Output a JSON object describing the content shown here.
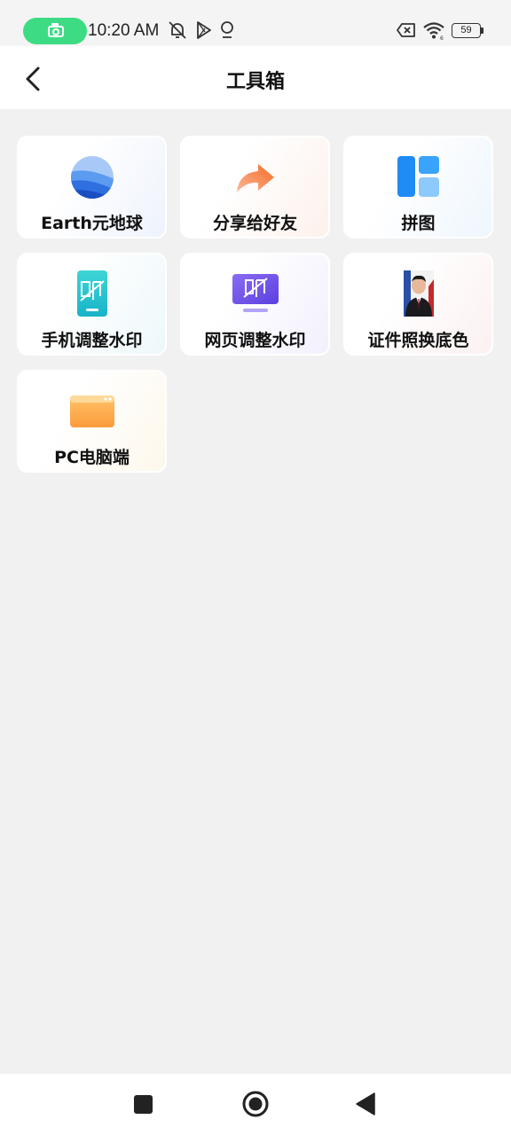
{
  "status_bar": {
    "time": "10:20 AM",
    "battery": "59",
    "icons": [
      "screen-record-icon",
      "mute-bell-icon",
      "play-store-icon",
      "location-icon",
      "no-sim-icon",
      "wifi-icon",
      "battery-icon"
    ]
  },
  "header": {
    "title": "工具箱",
    "back_icon": "chevron-left-icon"
  },
  "tools": [
    {
      "label": "Earth元地球",
      "icon": "earth-globe-icon",
      "tint": "#eef3fc"
    },
    {
      "label": "分享给好友",
      "icon": "share-arrow-icon",
      "tint": "#fdf1ec"
    },
    {
      "label": "拼图",
      "icon": "collage-layout-icon",
      "tint": "#eef6fd"
    },
    {
      "label": "手机调整水印",
      "icon": "phone-watermark-icon",
      "tint": "#edf8fb"
    },
    {
      "label": "网页调整水印",
      "icon": "web-watermark-icon",
      "tint": "#f2f0fd"
    },
    {
      "label": "证件照换底色",
      "icon": "id-photo-icon",
      "tint": "#fcf1f1"
    },
    {
      "label": "PC电脑端",
      "icon": "pc-window-icon",
      "tint": "#fdf8ec"
    }
  ],
  "nav_bar": {
    "icons": [
      "recents-square-icon",
      "home-circle-icon",
      "back-triangle-icon"
    ]
  },
  "colors": {
    "background": "#f1f1f1",
    "accent_green": "#3ddc84"
  }
}
